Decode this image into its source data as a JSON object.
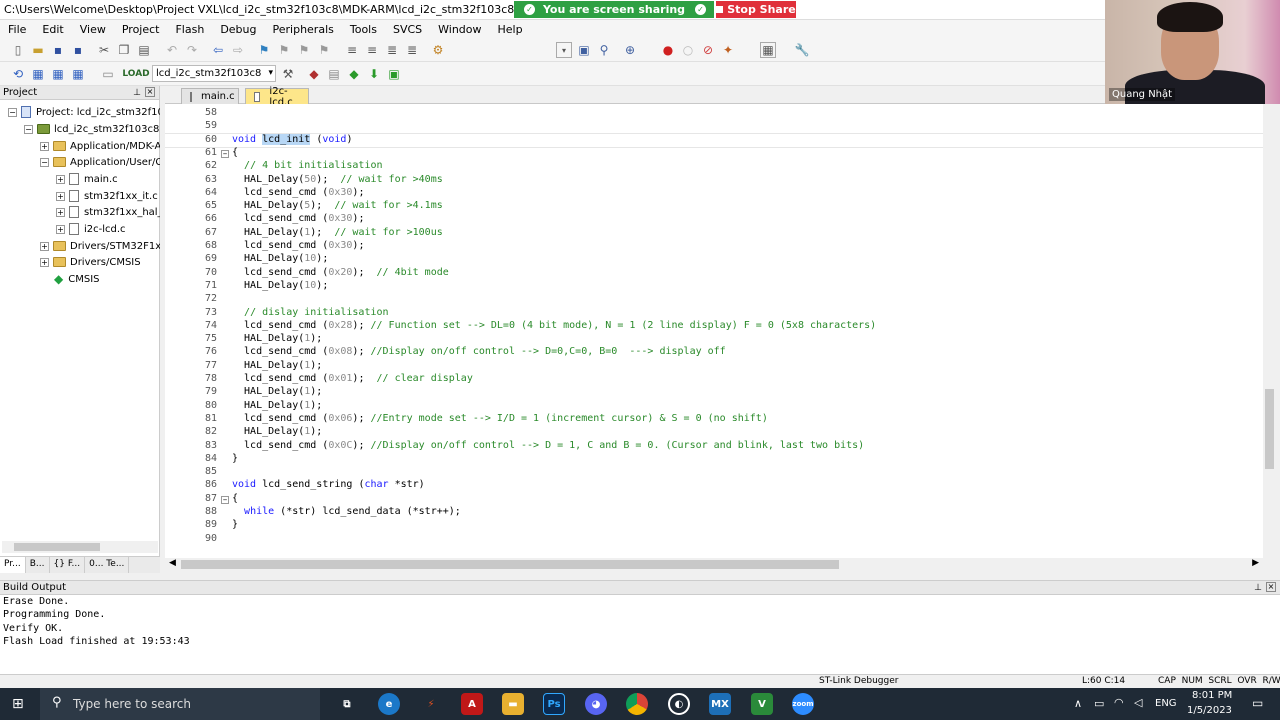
{
  "window": {
    "title": "C:\\Users\\Welcome\\Desktop\\Project VXL\\lcd_i2c_stm32f103c8\\MDK-ARM\\lcd_i2c_stm32f103c8.uvprojx - µVision"
  },
  "sharing": {
    "status": "You are screen sharing",
    "stop_label": "Stop Share"
  },
  "video": {
    "participant_name": "Quang Nhật"
  },
  "menu": [
    "File",
    "Edit",
    "View",
    "Project",
    "Flash",
    "Debug",
    "Peripherals",
    "Tools",
    "SVCS",
    "Window",
    "Help"
  ],
  "toolbar2": {
    "target": "lcd_i2c_stm32f103c8"
  },
  "project_panel": {
    "title": "Project",
    "items": [
      "Project: lcd_i2c_stm32f103c",
      "lcd_i2c_stm32f103c8",
      "Application/MDK-A",
      "Application/User/C",
      "main.c",
      "stm32f1xx_it.c",
      "stm32f1xx_hal_r",
      "i2c-lcd.c",
      "Drivers/STM32F1xx_",
      "Drivers/CMSIS",
      "CMSIS"
    ],
    "tabs": [
      "Pr...",
      "B...",
      "{} F...",
      "0... Te..."
    ]
  },
  "editor": {
    "tabs": [
      {
        "name": "main.c"
      },
      {
        "name": "i2c-lcd.c"
      }
    ],
    "lines": [
      {
        "n": "58",
        "code": ""
      },
      {
        "n": "59",
        "code": ""
      },
      {
        "n": "60",
        "code": "void lcd_init (void)"
      },
      {
        "n": "61",
        "code": "{"
      },
      {
        "n": "62",
        "code": "  // 4 bit initialisation"
      },
      {
        "n": "63",
        "code": "  HAL_Delay(50);  // wait for >40ms"
      },
      {
        "n": "64",
        "code": "  lcd_send_cmd (0x30);"
      },
      {
        "n": "65",
        "code": "  HAL_Delay(5);  // wait for >4.1ms"
      },
      {
        "n": "66",
        "code": "  lcd_send_cmd (0x30);"
      },
      {
        "n": "67",
        "code": "  HAL_Delay(1);  // wait for >100us"
      },
      {
        "n": "68",
        "code": "  lcd_send_cmd (0x30);"
      },
      {
        "n": "69",
        "code": "  HAL_Delay(10);"
      },
      {
        "n": "70",
        "code": "  lcd_send_cmd (0x20);  // 4bit mode"
      },
      {
        "n": "71",
        "code": "  HAL_Delay(10);"
      },
      {
        "n": "72",
        "code": ""
      },
      {
        "n": "73",
        "code": "  // dislay initialisation"
      },
      {
        "n": "74",
        "code": "  lcd_send_cmd (0x28); // Function set --> DL=0 (4 bit mode), N = 1 (2 line display) F = 0 (5x8 characters)"
      },
      {
        "n": "75",
        "code": "  HAL_Delay(1);"
      },
      {
        "n": "76",
        "code": "  lcd_send_cmd (0x08); //Display on/off control --> D=0,C=0, B=0  ---> display off"
      },
      {
        "n": "77",
        "code": "  HAL_Delay(1);"
      },
      {
        "n": "78",
        "code": "  lcd_send_cmd (0x01);  // clear display"
      },
      {
        "n": "79",
        "code": "  HAL_Delay(1);"
      },
      {
        "n": "80",
        "code": "  HAL_Delay(1);"
      },
      {
        "n": "81",
        "code": "  lcd_send_cmd (0x06); //Entry mode set --> I/D = 1 (increment cursor) & S = 0 (no shift)"
      },
      {
        "n": "82",
        "code": "  HAL_Delay(1);"
      },
      {
        "n": "83",
        "code": "  lcd_send_cmd (0x0C); //Display on/off control --> D = 1, C and B = 0. (Cursor and blink, last two bits)"
      },
      {
        "n": "84",
        "code": "}"
      },
      {
        "n": "85",
        "code": ""
      },
      {
        "n": "86",
        "code": "void lcd_send_string (char *str)"
      },
      {
        "n": "87",
        "code": "{"
      },
      {
        "n": "88",
        "code": "  while (*str) lcd_send_data (*str++);"
      },
      {
        "n": "89",
        "code": "}"
      },
      {
        "n": "90",
        "code": ""
      }
    ]
  },
  "build_output": {
    "title": "Build Output",
    "lines": [
      "Erase Done.",
      "Programming Done.",
      "Verify OK.",
      "Flash Load finished at 19:53:43"
    ]
  },
  "statusbar": {
    "debugger": "ST-Link Debugger",
    "position": "L:60 C:14",
    "indicators": "CAP  NUM  SCRL  OVR  R/W"
  },
  "taskbar": {
    "search_placeholder": "Type here to search",
    "lang": "ENG",
    "time": "8:01 PM",
    "date": "1/5/2023"
  },
  "colors": {
    "keyword": "#1a1aff",
    "comment": "#2a8a2a",
    "number": "#8a8a8a",
    "selection": "#b8d7f5",
    "share_green": "#2ea043",
    "stop_red": "#e0303a"
  }
}
